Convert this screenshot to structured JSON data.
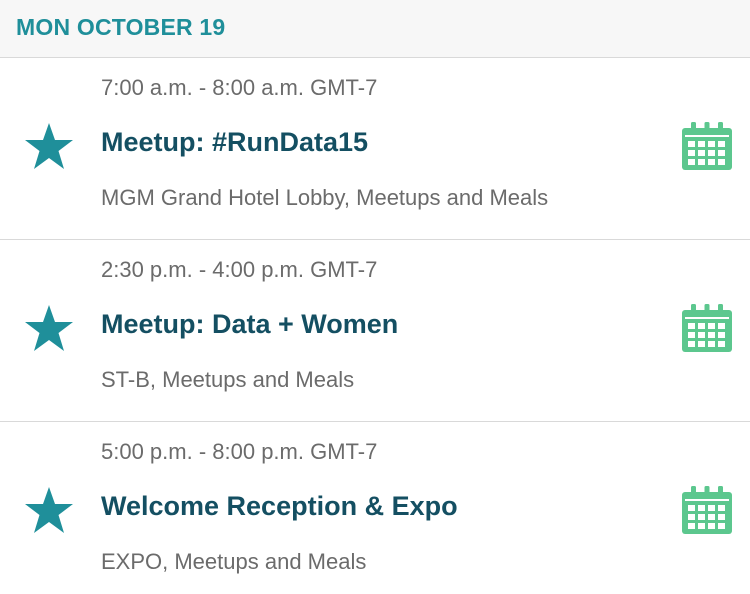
{
  "day": {
    "title": "MON OCTOBER 19"
  },
  "colors": {
    "accent": "#1f8f9a",
    "title": "#144f62",
    "calendar": "#5cc78e",
    "muted": "#6b6b6b"
  },
  "events": [
    {
      "time": "7:00 a.m. - 8:00 a.m. GMT-7",
      "title": "Meetup: #RunData15",
      "location": "MGM Grand Hotel Lobby, Meetups and Meals",
      "star_icon": "star-icon",
      "calendar_icon": "calendar-icon"
    },
    {
      "time": "2:30 p.m. - 4:00 p.m. GMT-7",
      "title": "Meetup: Data + Women",
      "location": "ST-B, Meetups and Meals",
      "star_icon": "star-icon",
      "calendar_icon": "calendar-icon"
    },
    {
      "time": "5:00 p.m. - 8:00 p.m. GMT-7",
      "title": "Welcome Reception & Expo",
      "location": "EXPO, Meetups and Meals",
      "star_icon": "star-icon",
      "calendar_icon": "calendar-icon"
    }
  ]
}
